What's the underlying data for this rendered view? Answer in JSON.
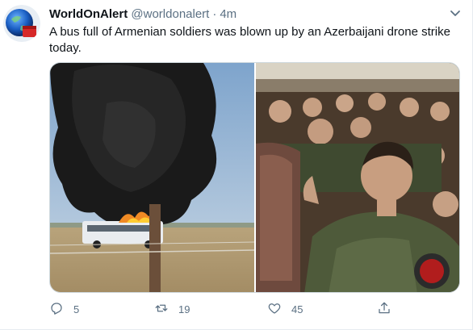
{
  "author": {
    "display_name": "WorldOnAlert",
    "handle": "@worldonalert",
    "separator": "·",
    "time": "4m"
  },
  "tweet": {
    "text": "A bus full of Armenian soldiers was blown up by an Azerbaijani drone strike today."
  },
  "actions": {
    "reply_count": "5",
    "retweet_count": "19",
    "like_count": "45"
  },
  "icons": {
    "reply": "reply-icon",
    "retweet": "retweet-icon",
    "like": "heart-icon",
    "share": "share-icon",
    "more": "chevron-down-icon"
  },
  "colors": {
    "text": "#0f1419",
    "secondary": "#5b7083",
    "border": "#cfd9de"
  }
}
